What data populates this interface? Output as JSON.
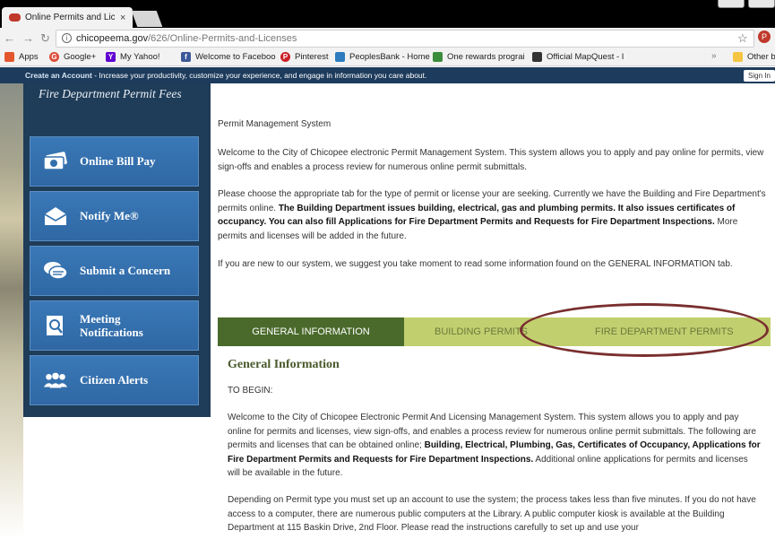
{
  "browser": {
    "tab_title": "Online Permits and Licen",
    "tab_close": "×",
    "url_host": "chicopeema.gov",
    "url_path": "/626/Online-Permits-and-Licenses",
    "star_icon": "star-icon",
    "bookmarks": [
      {
        "label": "Apps",
        "icon": "apps-icon",
        "color": "#e4572e"
      },
      {
        "label": "Google+",
        "icon": "google-plus-icon",
        "color": "#dd4b39"
      },
      {
        "label": "My Yahoo!",
        "icon": "yahoo-icon",
        "color": "#5f01d1"
      },
      {
        "label": "Welcome to Faceboo",
        "icon": "facebook-icon",
        "color": "#3b5998"
      },
      {
        "label": "Pinterest",
        "icon": "pinterest-icon",
        "color": "#cb2027"
      },
      {
        "label": "PeoplesBank - Home",
        "icon": "peoplesbank-icon",
        "color": "#2e7bbf"
      },
      {
        "label": "One rewards prograi",
        "icon": "rewards-icon",
        "color": "#3a8d3a"
      },
      {
        "label": "Official MapQuest - I",
        "icon": "mapquest-icon",
        "color": "#333333"
      }
    ],
    "bookmarks_overflow": "»",
    "other_bookmarks": "Other b"
  },
  "banner": {
    "link": "Create an Account",
    "text": " - Increase your productivity, customize your experience, and engage in information you care about.",
    "signin": "Sign In"
  },
  "sidebar": {
    "heading": "Fire Department Permit Fees",
    "items": [
      {
        "label": "Online Bill Pay",
        "icon": "bill-pay-icon"
      },
      {
        "label": "Notify Me®",
        "icon": "envelope-icon"
      },
      {
        "label": "Submit a Concern",
        "icon": "chat-icon"
      },
      {
        "label": "Meeting Notifications",
        "icon": "notification-icon"
      },
      {
        "label": "Citizen Alerts",
        "icon": "people-icon"
      }
    ]
  },
  "main": {
    "pms_label": "Permit Management System",
    "para1": "Welcome to the City of Chicopee electronic Permit Management System. This system allows you to apply and pay online for permits, view sign-offs and enables a process review for numerous online permit submittals.",
    "para2_a": "Please choose the appropriate tab for the type of permit or license your are seeking. Currently we have the Building and Fire Department's permits online. ",
    "para2_b": "The Building Department issues building, electrical, gas and plumbing permits. It also issues certificates of occupancy. You can also fill Applications for Fire Department Permits and Requests for Fire Department Inspections.",
    "para2_c": " More permits and licenses will be added in the future.",
    "para3": "If you are new to our system, we suggest you take  moment to read some information found on the GENERAL INFORMATION tab.",
    "tabs": [
      {
        "label": "GENERAL INFORMATION",
        "active": true
      },
      {
        "label": "BUILDING PERMITS",
        "active": false
      },
      {
        "label": "FIRE DEPARTMENT PERMITS",
        "active": false
      }
    ],
    "gi_title": "General Information",
    "to_begin": "TO BEGIN:",
    "gi_para1_a": "Welcome to the City of Chicopee Electronic Permit And Licensing Management System.  This system allows you to apply and pay online for permits and licenses, view sign-offs, and enables a process review for numerous online permit submittals.  The following are permits and licenses that can be obtained online; ",
    "gi_para1_b": "Building, Electrical, Plumbing, Gas, Certificates of Occupancy, Applications for Fire Department Permits and Requests for Fire Department Inspections.",
    "gi_para1_c": "  Additional online applications for permits and licenses will be available in the future.",
    "gi_para2": "Depending on Permit type you must set up an account to use the system; the process takes less than five minutes.  If you do not have access to a computer, there are numerous public computers at the Library.  A public computer kiosk is available at the Building Department at 115 Baskin Drive, 2nd Floor.  Please read the instructions carefully to set up and use your"
  },
  "colors": {
    "sidebar_bg": "#1f3c58",
    "button_blue": "#3270ad",
    "tab_active": "#4a6a2b",
    "tab_inactive": "#c2cf6f",
    "highlight_ellipse": "#7a2f2f",
    "banner_bg": "#1d3b5c"
  }
}
